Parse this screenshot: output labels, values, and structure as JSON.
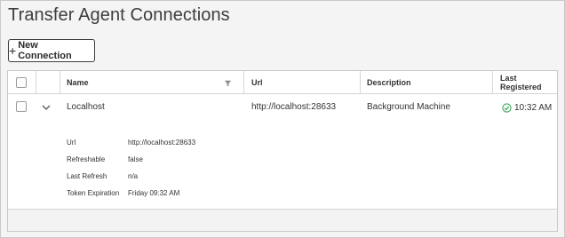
{
  "page": {
    "title": "Transfer Agent Connections"
  },
  "toolbar": {
    "new_connection_label": "New Connection"
  },
  "table": {
    "columns": {
      "name": "Name",
      "url": "Url",
      "description": "Description",
      "last_registered": "Last Registered"
    },
    "rows": [
      {
        "name": "Localhost",
        "url": "http://localhost:28633",
        "description": "Background Machine",
        "last_registered": "10:32 AM",
        "status_color": "#3aa655",
        "details": [
          {
            "label": "Url",
            "value": "http://localhost:28633"
          },
          {
            "label": "Refreshable",
            "value": "false"
          },
          {
            "label": "Last Refresh",
            "value": "n/a"
          },
          {
            "label": "Token Expiration",
            "value": "Friday 09:32 AM"
          }
        ]
      }
    ]
  }
}
